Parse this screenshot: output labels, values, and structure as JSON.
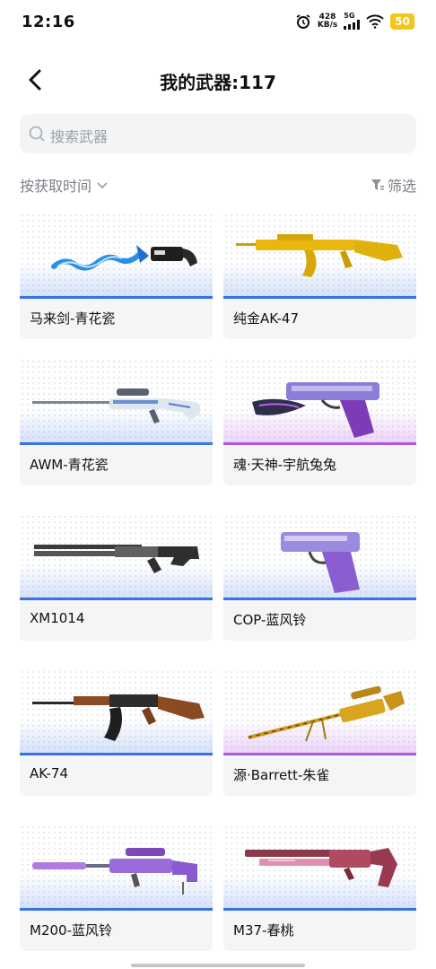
{
  "status_bar": {
    "time": "12:16",
    "net_speed_top": "428",
    "net_speed_bottom": "KB/s",
    "signal": "5G",
    "battery": "50"
  },
  "header": {
    "title": "我的武器:117"
  },
  "search": {
    "placeholder": "搜索武器"
  },
  "sort": {
    "label": "按获取时间"
  },
  "filter": {
    "label": "筛选"
  },
  "weapons": [
    {
      "name": "马来剑-青花瓷",
      "rarity": "blue"
    },
    {
      "name": "纯金AK-47",
      "rarity": "blue"
    },
    {
      "name": "AWM-青花瓷",
      "rarity": "blue"
    },
    {
      "name": "魂·天神-宇航兔兔",
      "rarity": "purple"
    },
    {
      "name": "XM1014",
      "rarity": "blue"
    },
    {
      "name": "COP-蓝风铃",
      "rarity": "blue"
    },
    {
      "name": "AK-74",
      "rarity": "blue"
    },
    {
      "name": "源·Barrett-朱雀",
      "rarity": "purple"
    },
    {
      "name": "M200-蓝风铃",
      "rarity": "blue"
    },
    {
      "name": "M37-春桃",
      "rarity": "blue"
    }
  ],
  "colors": {
    "blue_line": "#3a72e0",
    "purple_line": "#b05ad8"
  }
}
